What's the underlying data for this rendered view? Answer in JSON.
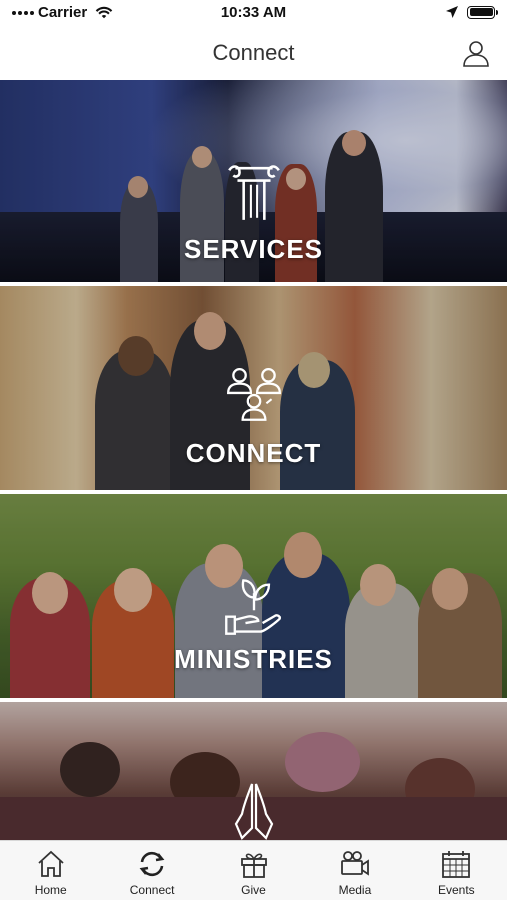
{
  "status": {
    "carrier": "Carrier",
    "time": "10:33 AM"
  },
  "nav": {
    "title": "Connect"
  },
  "tiles": [
    {
      "label": "SERVICES",
      "icon": "pillar-icon"
    },
    {
      "label": "CONNECT",
      "icon": "people-group-icon"
    },
    {
      "label": "MINISTRIES",
      "icon": "hand-plant-icon"
    },
    {
      "label": "",
      "icon": "praying-hands-icon"
    }
  ],
  "tabs": [
    {
      "label": "Home",
      "icon": "home-icon"
    },
    {
      "label": "Connect",
      "icon": "refresh-arrows-icon"
    },
    {
      "label": "Give",
      "icon": "gift-icon"
    },
    {
      "label": "Media",
      "icon": "video-camera-icon"
    },
    {
      "label": "Events",
      "icon": "calendar-icon"
    }
  ],
  "colors": {
    "tab_icon": "#333333",
    "tile_text": "#ffffff"
  }
}
